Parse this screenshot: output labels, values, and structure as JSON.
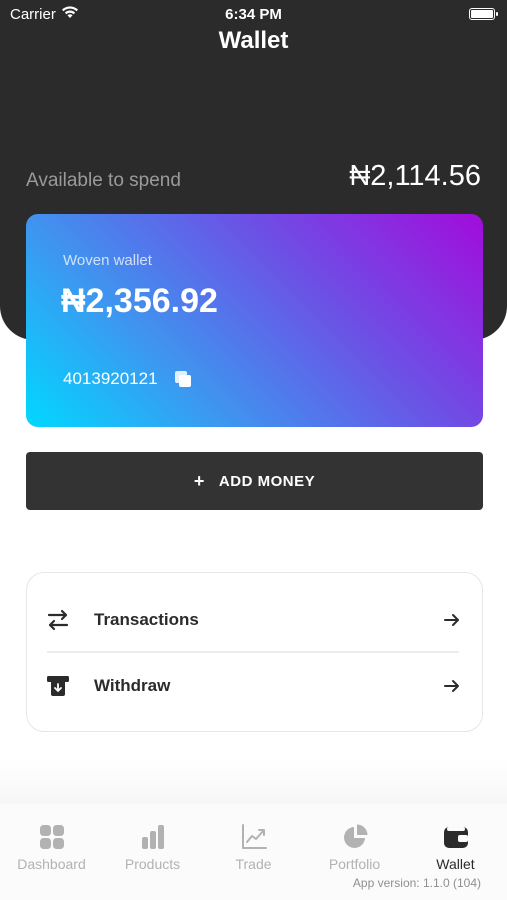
{
  "status_bar": {
    "carrier": "Carrier",
    "time": "6:34 PM"
  },
  "header": {
    "title": "Wallet"
  },
  "balance": {
    "label": "Available to spend",
    "amount": "₦2,114.56"
  },
  "wallet_card": {
    "label": "Woven wallet",
    "balance": "₦2,356.92",
    "account_number": "4013920121"
  },
  "actions": {
    "add_money_label": "ADD MONEY"
  },
  "menu": {
    "items": [
      {
        "label": "Transactions",
        "icon": "swap-arrows-icon"
      },
      {
        "label": "Withdraw",
        "icon": "atm-withdraw-icon"
      }
    ]
  },
  "tabs": [
    {
      "label": "Dashboard",
      "icon": "grid-icon",
      "active": false
    },
    {
      "label": "Products",
      "icon": "bar-chart-icon",
      "active": false
    },
    {
      "label": "Trade",
      "icon": "trend-chart-icon",
      "active": false
    },
    {
      "label": "Portfolio",
      "icon": "pie-chart-icon",
      "active": false
    },
    {
      "label": "Wallet",
      "icon": "wallet-icon",
      "active": true
    }
  ],
  "app_version": "App version: 1.1.0 (104)",
  "colors": {
    "header_bg": "#2b2b2b",
    "button_bg": "#333333",
    "card_gradient_start": "#00d8ff",
    "card_gradient_end": "#a20cdc",
    "tab_inactive": "#b2b2b2",
    "tab_active": "#2b2b2b"
  }
}
